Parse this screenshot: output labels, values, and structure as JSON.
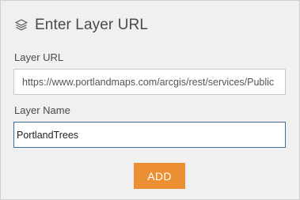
{
  "header": {
    "title": "Enter Layer URL",
    "icon": "layers-icon"
  },
  "form": {
    "url_label": "Layer URL",
    "url_value": "https://www.portlandmaps.com/arcgis/rest/services/Public",
    "name_label": "Layer Name",
    "name_value": "PortlandTrees",
    "add_label": "ADD"
  },
  "colors": {
    "accent": "#ec8f32",
    "focus_border": "#3e6e9e",
    "panel_background": "#f0f0f0"
  }
}
